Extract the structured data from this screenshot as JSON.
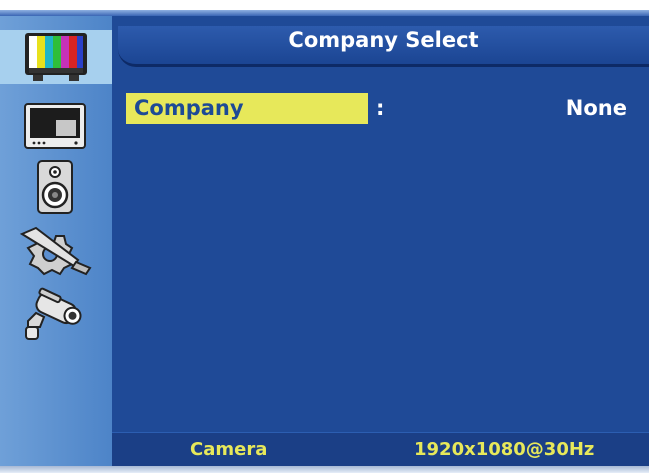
{
  "header": {
    "title": "Company Select"
  },
  "sidebar": {
    "items": [
      {
        "icon": "color-bars-icon",
        "active": true
      },
      {
        "icon": "monitor-icon",
        "active": false
      },
      {
        "icon": "speaker-icon",
        "active": false
      },
      {
        "icon": "tools-icon",
        "active": false
      },
      {
        "icon": "camera-icon",
        "active": false
      }
    ]
  },
  "settings": {
    "rows": [
      {
        "label": "Company",
        "separator": ":",
        "value": "None"
      }
    ]
  },
  "footer": {
    "source": "Camera",
    "resolution": "1920x1080@30Hz"
  },
  "colors": {
    "panel": "#1f4a97",
    "highlight": "#e7e85a",
    "sidebar": "#5b8fd0",
    "sidebar_active": "#a7d0ee"
  }
}
